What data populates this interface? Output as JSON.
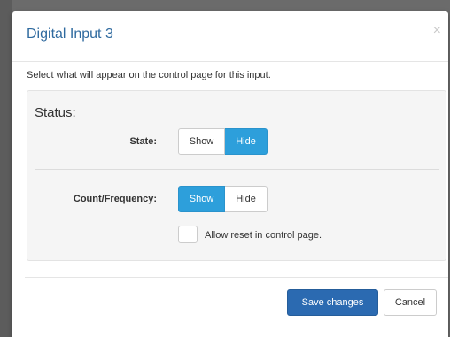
{
  "modal": {
    "title": "Digital Input 3",
    "close_glyph": "×",
    "intro": "Select what will appear on the control page for this input.",
    "section_heading": "Status:",
    "state": {
      "label": "State:",
      "options": [
        "Show",
        "Hide"
      ],
      "selected": "Hide"
    },
    "count_frequency": {
      "label": "Count/Frequency:",
      "options": [
        "Show",
        "Hide"
      ],
      "selected": "Show"
    },
    "allow_reset": {
      "label": "Allow reset in control page.",
      "checked": false
    },
    "footer": {
      "save_label": "Save changes",
      "cancel_label": "Cancel"
    }
  },
  "colors": {
    "title": "#2f6a9f",
    "toggle_active": "#2d9fdb",
    "primary_button": "#2b6ab1"
  },
  "icons": {
    "close": "close-icon"
  }
}
